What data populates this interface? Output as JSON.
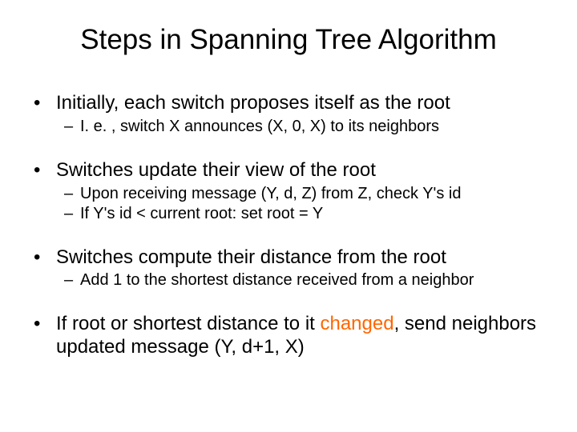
{
  "title": "Steps in Spanning Tree Algorithm",
  "bullets": [
    {
      "text": "Initially, each switch proposes itself as the root",
      "subs": [
        "I. e. , switch X announces (X, 0, X) to its neighbors"
      ]
    },
    {
      "text": "Switches update their view of the root",
      "subs": [
        "Upon receiving message (Y, d, Z) from Z, check Y's id",
        "If Y's id  < current root: set root = Y"
      ]
    },
    {
      "text": "Switches compute their distance from the root",
      "subs": [
        "Add 1 to the shortest distance received from a neighbor"
      ]
    },
    {
      "text_pre": "If root or shortest distance to it ",
      "highlight": "changed",
      "text_post": ", send neighbors updated message (Y, d+1, X)",
      "subs": []
    }
  ]
}
